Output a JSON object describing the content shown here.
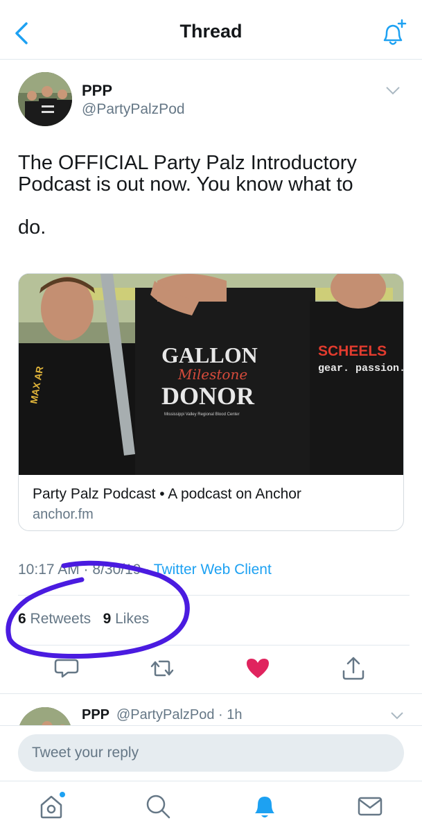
{
  "header": {
    "title": "Thread"
  },
  "tweet": {
    "name": "PPP",
    "handle": "@PartyPalzPod",
    "text_lines": [
      "The OFFICIAL Party Palz Introductory",
      "Podcast is out now. You know what to",
      "do."
    ],
    "card": {
      "title": "Party Palz Podcast • A podcast on Anchor",
      "domain": "anchor.fm",
      "image_text": {
        "shirt_line1": "GALLON",
        "shirt_line2": "Milestone",
        "shirt_line3": "DONOR",
        "shirt_line4": "Mississippi Valley Regional Blood Center",
        "right_shirt1": "SCHEELS",
        "right_shirt2": "gear. passion. spor",
        "left_strap": "MAX AR"
      }
    },
    "timestamp": "10:17 AM · 8/30/19",
    "separator": "·",
    "source": "Twitter Web Client",
    "retweets_count": "6",
    "retweets_label": "Retweets",
    "likes_count": "9",
    "likes_label": "Likes"
  },
  "reply_preview": {
    "name": "PPP",
    "handle": "@PartyPalzPod · 1h"
  },
  "reply_box": {
    "placeholder": "Tweet your reply"
  },
  "colors": {
    "accent": "#1da1f2",
    "like": "#e0245e",
    "annotation": "#4a1be0"
  }
}
